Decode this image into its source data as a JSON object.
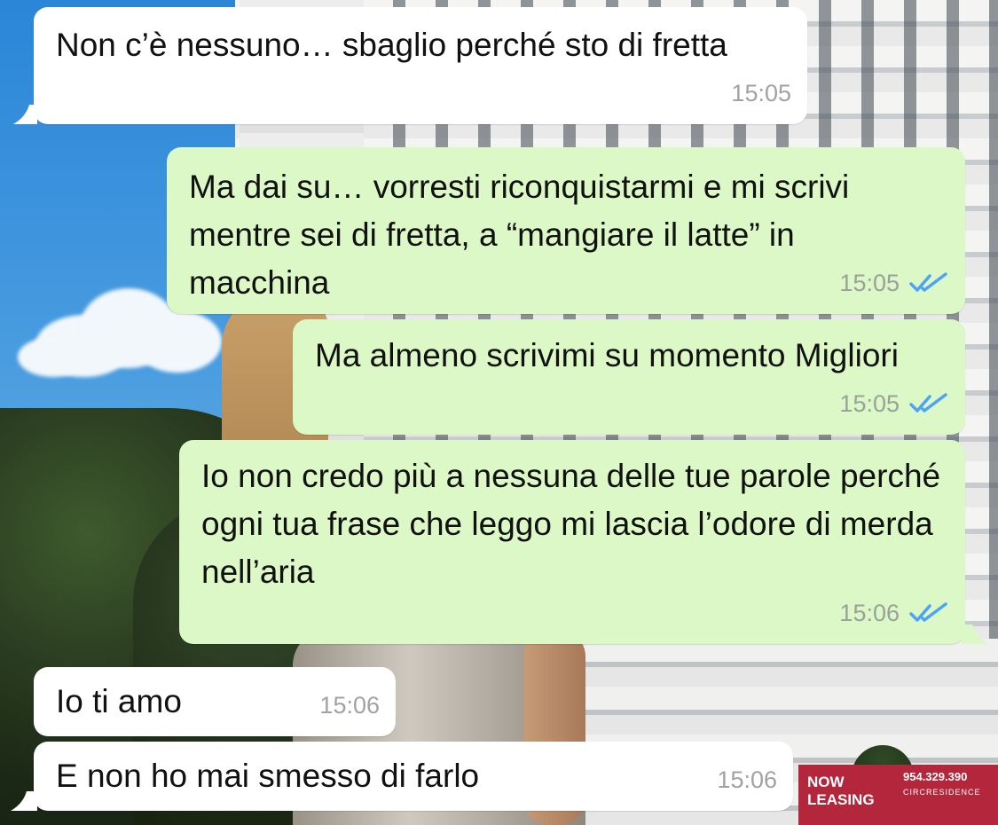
{
  "messages": [
    {
      "text": "Non c’è nessuno… sbaglio perché sto di fretta",
      "time": "15:05",
      "direction": "in"
    },
    {
      "text": "Ma dai su… vorresti riconquistarmi e mi scrivi mentre sei di fretta, a “mangiare il latte” in macchina",
      "time": "15:05",
      "direction": "out",
      "status": "read"
    },
    {
      "text": "Ma almeno scrivimi su momento Migliori",
      "time": "15:05",
      "direction": "out",
      "status": "read"
    },
    {
      "text": "Io non credo più a nessuna delle tue parole perché ogni tua frase che leggo mi lascia l’odore di merda nell’aria",
      "time": "15:06",
      "direction": "out",
      "status": "read"
    },
    {
      "text": "Io ti amo",
      "time": "15:06",
      "direction": "in"
    },
    {
      "text": "E non ho mai smesso di farlo",
      "time": "15:06",
      "direction": "in"
    }
  ],
  "wallpaper": {
    "sign_line1": "NOW",
    "sign_line2": "LEASING",
    "sign_phone": "954.329.390",
    "sign_brand": "CIRCRESIDENCE"
  },
  "colors": {
    "incoming_bubble": "#ffffff",
    "outgoing_bubble": "#dcf8c6",
    "read_ticks": "#4fa3f7",
    "timestamp": "#9aa19a"
  }
}
